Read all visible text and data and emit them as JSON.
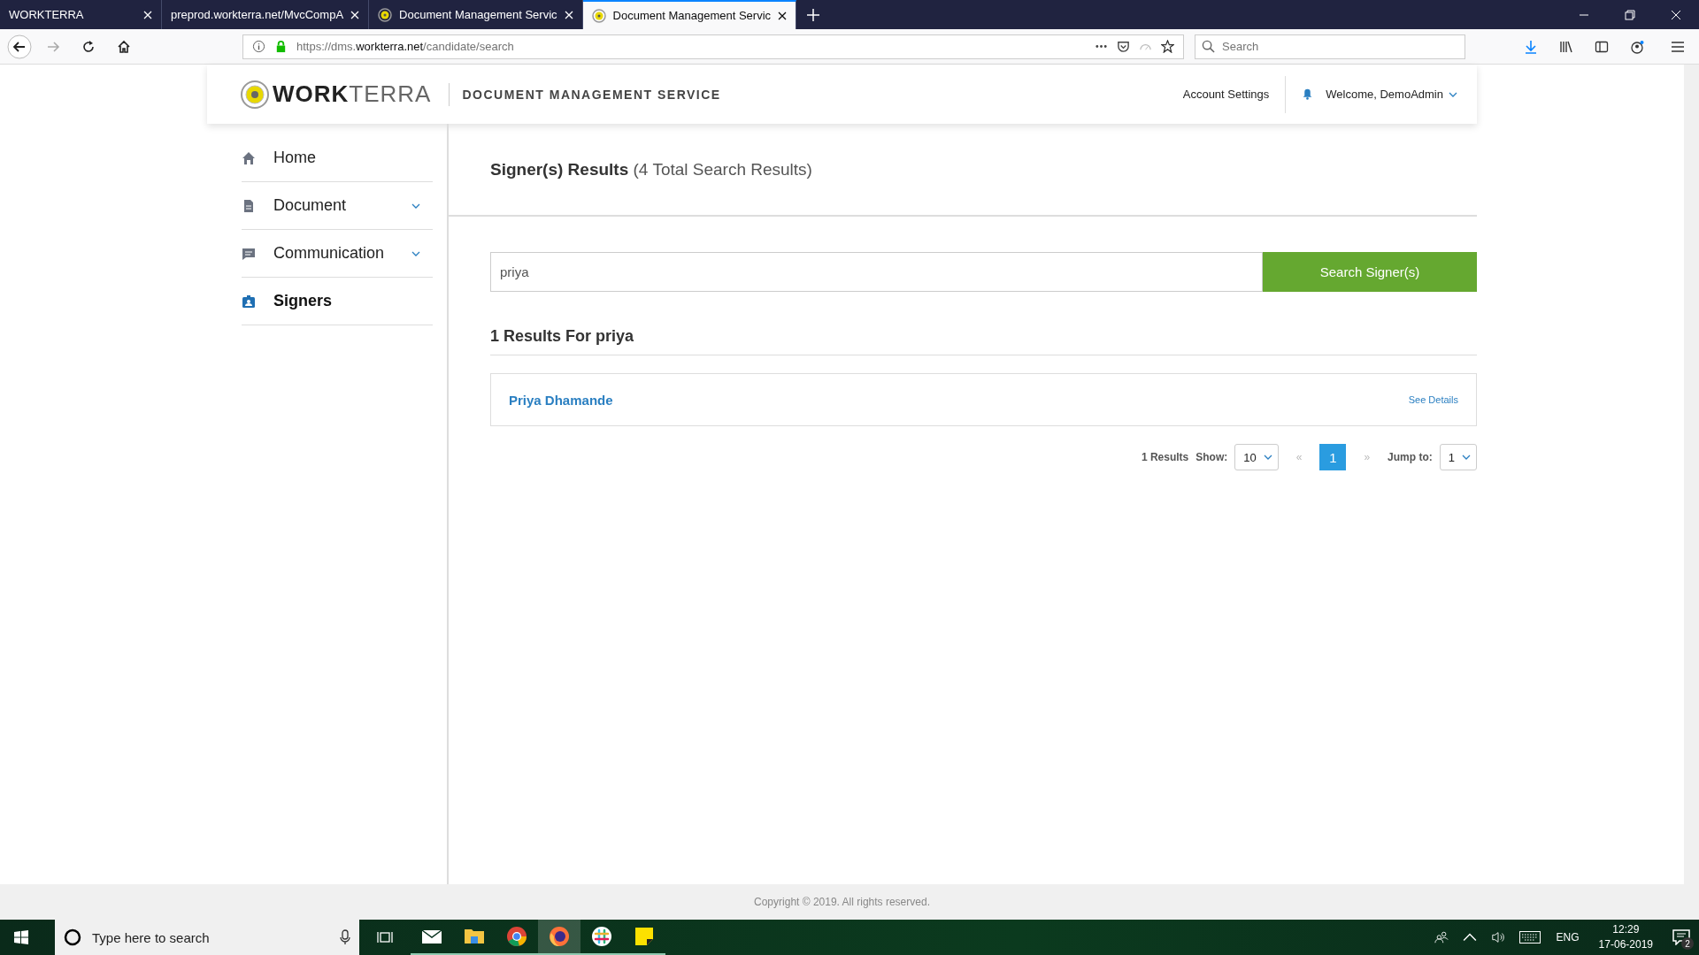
{
  "browser": {
    "tabs": [
      {
        "title": "WORKTERRA",
        "icon": false,
        "selected": false
      },
      {
        "title": "preprod.workterra.net/MvcCompA",
        "icon": false,
        "selected": false
      },
      {
        "title": "Document Management Servic",
        "icon": true,
        "selected": false
      },
      {
        "title": "Document Management Servic",
        "icon": true,
        "selected": true
      }
    ],
    "url": {
      "prefix": "https://dms.",
      "domain": "workterra.net",
      "path": "/candidate/search"
    },
    "search": {
      "placeholder": "Search"
    }
  },
  "app": {
    "logo": {
      "bold": "WORK",
      "light": "TERRA"
    },
    "service_title": "DOCUMENT MANAGEMENT SERVICE",
    "account_settings": "Account Settings",
    "welcome": "Welcome, DemoAdmin"
  },
  "sidebar": {
    "items": [
      {
        "label": "Home",
        "kind": "home",
        "expandable": false,
        "selected": false
      },
      {
        "label": "Document",
        "kind": "document",
        "expandable": true,
        "selected": false
      },
      {
        "label": "Communication",
        "kind": "communication",
        "expandable": true,
        "selected": false
      },
      {
        "label": "Signers",
        "kind": "signers",
        "expandable": false,
        "selected": true
      }
    ]
  },
  "content": {
    "title": "Signer(s) Results",
    "count": "(4 Total Search Results)",
    "search": {
      "value": "priya",
      "button": "Search Signer(s)"
    },
    "results_heading": "1 Results For priya",
    "results": [
      {
        "name": "Priya Dhamande",
        "action": "See Details"
      }
    ],
    "pagination": {
      "count": "1 Results",
      "show_label": "Show:",
      "page_size": "10",
      "prev": "«",
      "pages": [
        {
          "label": "1",
          "selected": true
        }
      ],
      "next": "»",
      "jump_label": "Jump to:",
      "jump_value": "1"
    }
  },
  "footer": "Copyright © 2019. All rights reserved.",
  "taskbar": {
    "search_placeholder": "Type here to search",
    "apps": [
      {
        "kind": "mail",
        "selected": false
      },
      {
        "kind": "folder",
        "selected": false
      },
      {
        "kind": "chrome",
        "selected": false
      },
      {
        "kind": "firefox",
        "selected": true
      },
      {
        "kind": "slack",
        "selected": false
      },
      {
        "kind": "notes",
        "selected": false
      }
    ],
    "language": "ENG",
    "time": "12:29",
    "date": "17-06-2019",
    "notifications": "2"
  }
}
